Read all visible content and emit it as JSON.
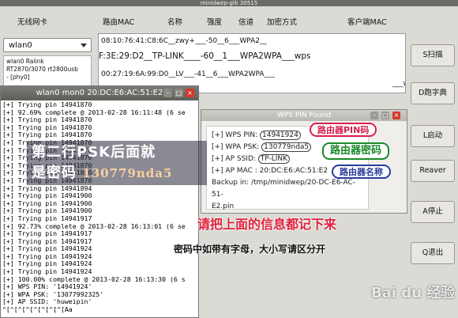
{
  "window": {
    "title": "minidwep-gtk 30515"
  },
  "columns": {
    "wireless_card": "无线网卡",
    "router_mac": "路由MAC",
    "name": "名称",
    "strength": "强度",
    "channel": "信道",
    "encryption": "加密方式",
    "client_mac": "客户端MAC"
  },
  "wlan": {
    "selected": "wlan0",
    "info_1": "wlan0 Ralink",
    "info_2": "RT2870/3070 rt2800usb",
    "info_3": "- [phy0]"
  },
  "ap_list": [
    "08:10:76:41:C8:6C__zwy+___-50__6___WPA2__",
    "F:3E:29:D2__TP-LINK____-60__1___WPA2WPA___wps",
    "00:27:19:6A:99:D0__LV___-41__6___WPA2WPA___",
    "___wps"
  ],
  "buttons": {
    "scan": "S扫描",
    "dict": "D跑字典",
    "launch": "L启动",
    "reaver": "Reaver",
    "stop": "A停止",
    "quit": "Q退出"
  },
  "terminal": {
    "title": "wlan0 mon0 20:DC:E6:AC:51:E2",
    "lines": [
      "[+] Trying pin 14941870",
      "[+] 92.69% complete @ 2013-02-28 16:11:48 (6 se",
      "[+] Trying pin 14941870",
      "[+] Trying pin 14941870",
      "[+] Trying pin 14941870",
      "[+] Trying pin 14941870",
      "[+] Trying pin 14941870",
      "[+] Trying pin 14941870",
      "[+] Trying pin 14941870",
      "[+] Trying pin 14941870",
      "[+] Trying pin 14941870",
      "[+] Trying pin 14941894",
      "[+] Trying pin 14941900",
      "[+] Trying pin 14941900",
      "[+] Trying pin 14941900",
      "[+] Trying pin 14941917",
      "[+] 92.73% complete @ 2013-02-28 16:13:01 (6 se",
      "[+] Trying pin 14941917",
      "[+] Trying pin 14941917",
      "[+] Trying pin 14941924",
      "[+] Trying pin 14941924",
      "[+] Trying pin 14941924",
      "[+] Trying pin 14941924",
      "[+] 100.00% complete @ 2013-02-28 16:13:30 (6 s",
      "[+] WPS PIN: '14941924'",
      "[+] WPA PSK: '13077992325'",
      "[+] AP SSID: 'huweipin'",
      "^[^[^[^[^[^[^[^[Aa"
    ]
  },
  "dialog": {
    "title": "WPS PIN Found",
    "pin_label": "[+] WPS PIN: ",
    "pin_value": "14941924",
    "psk_label": "[+] WPA PSK: ",
    "psk_value": "130779nda5",
    "ssid_label": "[+] AP SSID: ",
    "ssid_value": "TP-LINK",
    "mac_line": "[+] AP MAC : 20:DC:E6:AC:51:E2",
    "backup_line_1": "Backup in: /tmp/minidwep/20-DC-E6-AC-51-",
    "backup_line_2": "E2.pin"
  },
  "annotations": {
    "pin_callout": "路由器PIN码",
    "psk_callout": "路由器密码",
    "ssid_callout": "路由器名称",
    "psk_note_1": "第二行PSK后面就",
    "psk_note_2": "是密码 ",
    "psk_note_code": "130779nda5",
    "record_note": "请把上面的信息都记下来",
    "case_note": "密码中如带有字母，大小写请区分开",
    "watermark": "Bai du 经验"
  },
  "colors": {
    "pin_callout": "#d8204a",
    "psk_callout": "#1a8a2a",
    "ssid_callout": "#2a3b9a",
    "record_note": "#e0203c"
  }
}
